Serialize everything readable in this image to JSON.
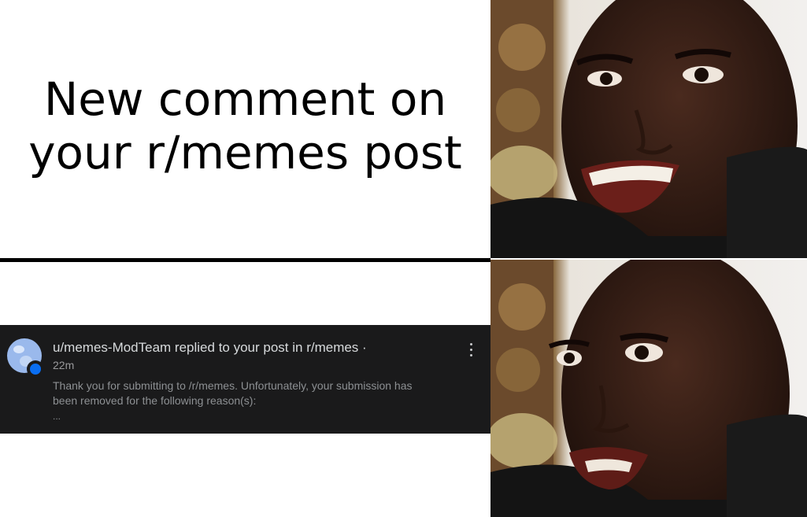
{
  "caption": {
    "line1": "New comment on",
    "line2": "your r/memes post"
  },
  "notification": {
    "title": "u/memes-ModTeam replied to your post in r/memes ·",
    "time": "22m",
    "body": "Thank you for submitting to /r/memes. Unfortunately, your submission has been removed for the following reason(s):",
    "ellipsis": "...",
    "avatar_color": "#9ab9ec",
    "badge_color": "#0a6ef2",
    "background_color": "#1a1a1b"
  },
  "photos": {
    "top": {
      "expression": "smiling"
    },
    "bottom": {
      "expression": "disappointed"
    }
  }
}
